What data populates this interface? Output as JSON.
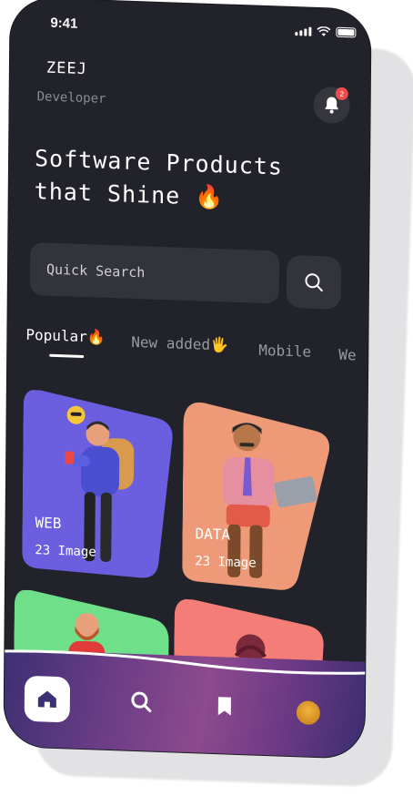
{
  "status_bar": {
    "time": "9:41"
  },
  "header": {
    "brand": "ZEEJ",
    "role": "Developer",
    "notification_count": "2"
  },
  "headline": "Software Products\nthat Shine 🔥",
  "search": {
    "placeholder": "Quick Search"
  },
  "tabs": [
    {
      "label": "Popular🔥",
      "active": true
    },
    {
      "label": "New added🖐",
      "active": false
    },
    {
      "label": "Mobile",
      "active": false
    },
    {
      "label": "We",
      "active": false
    }
  ],
  "cards": [
    {
      "label": "WEB",
      "count": "23 Image",
      "color": "#6b5fe0"
    },
    {
      "label": "DATA",
      "count": "23 Image",
      "color": "#ee9a78"
    },
    {
      "label": "",
      "count": "",
      "color": "#6fe089"
    },
    {
      "label": "",
      "count": "",
      "color": "#f47d78"
    }
  ],
  "bottom_nav": {
    "items": [
      "home-icon",
      "search-icon",
      "bookmark-icon",
      "avatar"
    ],
    "active": "home"
  },
  "colors": {
    "background": "#22232a",
    "surface": "#32333b",
    "badge": "#ef4b4b"
  }
}
